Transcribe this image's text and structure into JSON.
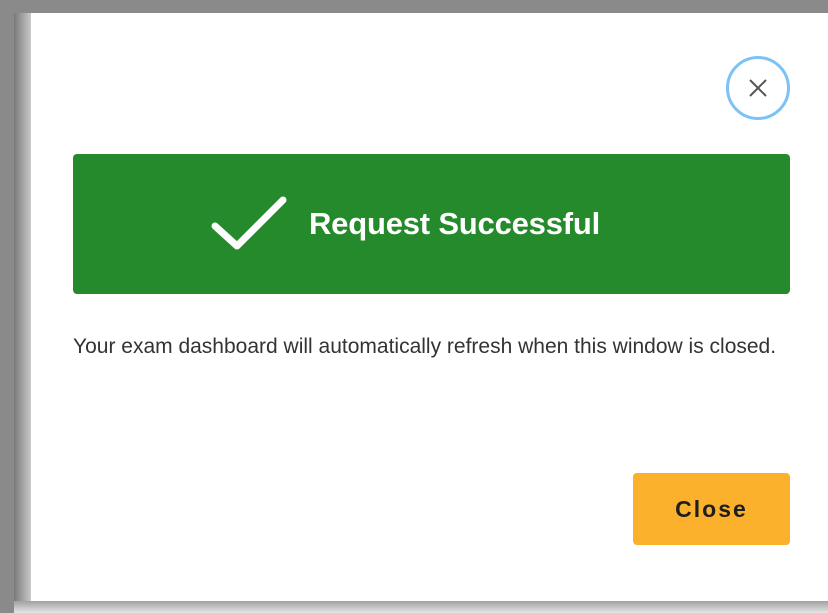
{
  "dialog": {
    "close_icon": "close-icon",
    "banner": {
      "icon": "checkmark-icon",
      "title": "Request Successful",
      "color": "#258a2b"
    },
    "message": "Your exam dashboard will automatically refresh when this window is closed.",
    "close_button_label": "Close",
    "close_button_color": "#fbb12c",
    "close_icon_ring_color": "#7cc3f5"
  }
}
